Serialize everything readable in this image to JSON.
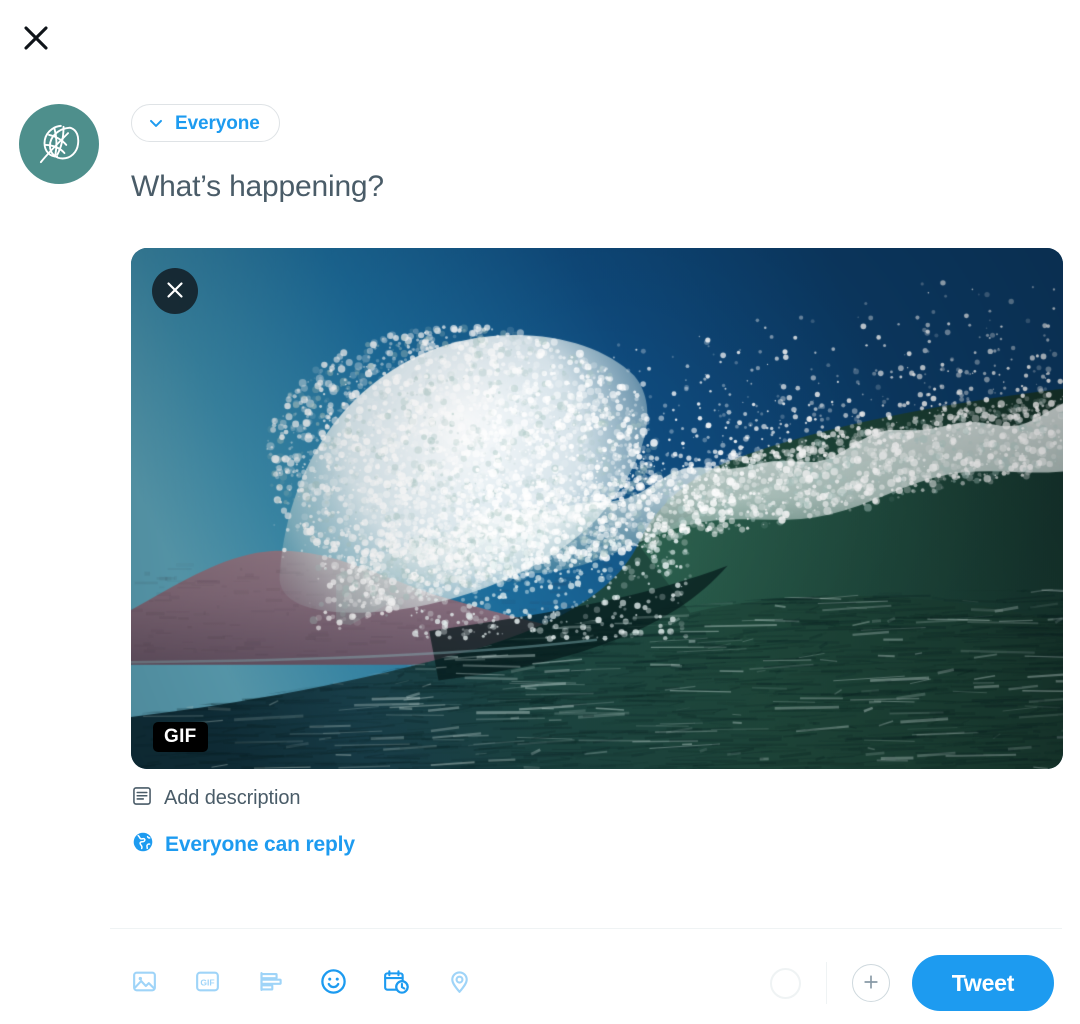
{
  "window": {
    "title": "Compose Tweet",
    "background": "#ffffff"
  },
  "colors": {
    "accent_blue": "#1D9BF0",
    "text_primary": "#0F1419",
    "text_secondary": "#4A5C68",
    "border": "#EFF3F4",
    "avatar_bg": "#4E8F8C",
    "badge_bg": "#000000"
  },
  "header": {
    "close_icon": "close-icon",
    "close_label": "Close"
  },
  "account": {
    "avatar_icon": "leaf-logo-icon",
    "avatar_alt": "Profile photo"
  },
  "audience": {
    "icon": "chevron-down-icon",
    "label": "Everyone"
  },
  "composer": {
    "placeholder": "What’s happening?",
    "value": ""
  },
  "media": {
    "type": "gif",
    "badge_label": "GIF",
    "remove_icon": "close-icon",
    "remove_label": "Remove media",
    "alt": "Ocean wave breaking with white spray against a blue sky and a mountain ridge in the distance",
    "description": {
      "icon": "description-icon",
      "label": "Add description"
    }
  },
  "reply_setting": {
    "icon": "globe-icon",
    "label": "Everyone can reply"
  },
  "toolbar": {
    "actions": [
      {
        "name": "media-icon",
        "label": "Media",
        "enabled": false
      },
      {
        "name": "gif-icon",
        "label": "GIF",
        "enabled": false
      },
      {
        "name": "poll-icon",
        "label": "Poll",
        "enabled": false
      },
      {
        "name": "emoji-icon",
        "label": "Emoji",
        "enabled": true
      },
      {
        "name": "schedule-icon",
        "label": "Schedule",
        "enabled": true
      },
      {
        "name": "location-icon",
        "label": "Tag location",
        "enabled": false
      }
    ],
    "char_progress_percent": 0,
    "add_thread_icon": "plus-icon",
    "add_thread_label": "Add another Tweet",
    "submit_label": "Tweet"
  }
}
